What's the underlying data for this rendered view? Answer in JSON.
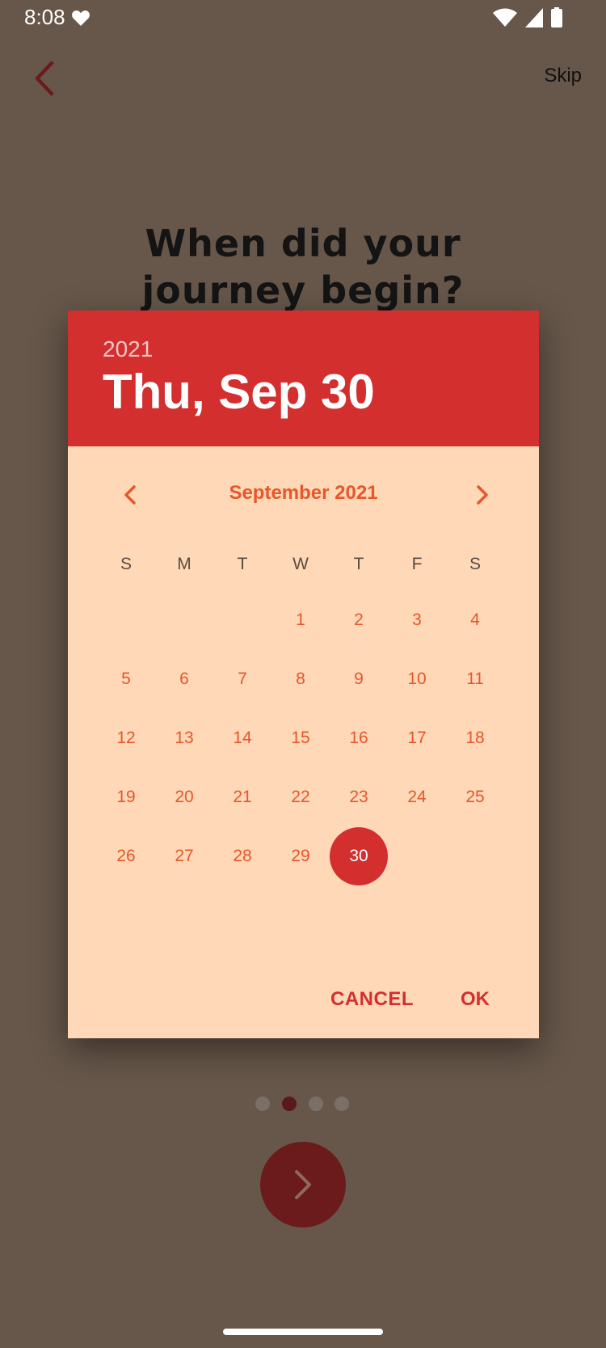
{
  "status_bar": {
    "time": "8:08",
    "icons": [
      "heart-icon",
      "wifi-icon",
      "signal-icon",
      "battery-icon"
    ]
  },
  "top_bar": {
    "back_icon": "chevron-left-icon",
    "skip_label": "Skip"
  },
  "question": "When did your journey begin?",
  "dialog": {
    "header_year": "2021",
    "header_date": "Thu, Sep 30",
    "month_title": "September 2021",
    "weekdays": [
      "S",
      "M",
      "T",
      "W",
      "T",
      "F",
      "S"
    ],
    "days": [
      "1",
      "2",
      "3",
      "4",
      "5",
      "6",
      "7",
      "8",
      "9",
      "10",
      "11",
      "12",
      "13",
      "14",
      "15",
      "16",
      "17",
      "18",
      "19",
      "20",
      "21",
      "22",
      "23",
      "24",
      "25",
      "26",
      "27",
      "28",
      "29",
      "30"
    ],
    "first_weekday_index": 3,
    "selected_day": "30",
    "cancel_label": "CANCEL",
    "ok_label": "OK"
  },
  "pager": {
    "page_count": 4,
    "active_page": 2
  },
  "colors": {
    "background": "#67574a",
    "dialog_header": "#d32f2f",
    "dialog_body": "#fed8b7",
    "accent_text": "#e8562a",
    "button_text": "#d32f2f",
    "next_button": "#6b1b1b"
  }
}
